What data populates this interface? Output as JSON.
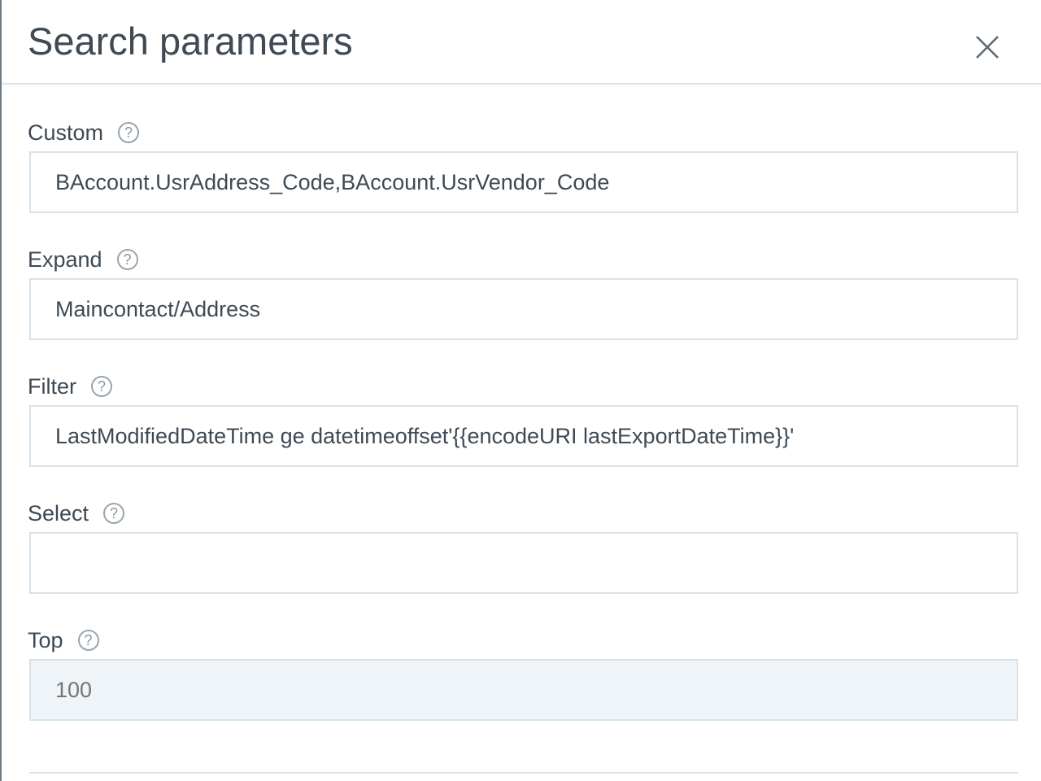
{
  "dialog": {
    "title": "Search parameters",
    "close_icon": "close-icon"
  },
  "fields": {
    "custom": {
      "label": "Custom",
      "help": "?",
      "value": "BAccount.UsrAddress_Code,BAccount.UsrVendor_Code"
    },
    "expand": {
      "label": "Expand",
      "help": "?",
      "value": "Maincontact/Address"
    },
    "filter": {
      "label": "Filter",
      "help": "?",
      "value": "LastModifiedDateTime ge datetimeoffset'{{encodeURI lastExportDateTime}}'"
    },
    "select": {
      "label": "Select",
      "help": "?",
      "value": ""
    },
    "top": {
      "label": "Top",
      "help": "?",
      "placeholder": "100"
    }
  },
  "colors": {
    "border": "#d7e2ea",
    "text": "#3d4a55",
    "disabled_bg": "#eff4f8"
  }
}
